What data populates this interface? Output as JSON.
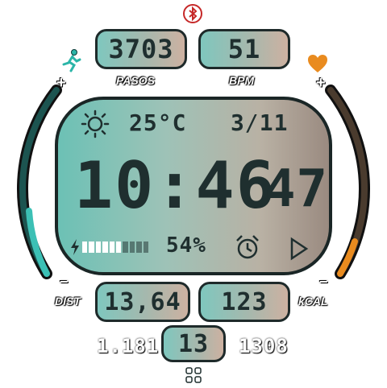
{
  "top": {
    "bluetooth_icon": "bluetooth-icon"
  },
  "steps": {
    "value": "3703",
    "label": "PASOS"
  },
  "heart": {
    "value": "51",
    "label": "BPM"
  },
  "main": {
    "temperature": "25°C",
    "date_day": "3",
    "date_sep": "/",
    "date_month": "11",
    "time_hm": "10:46",
    "time_sec": "47",
    "battery_pct": "54%",
    "battery_level": 0.54
  },
  "left_gauge": {
    "plus": "+",
    "minus": "−"
  },
  "right_gauge": {
    "plus": "+",
    "minus": "−"
  },
  "distance": {
    "value": "13,64",
    "label": "DIST"
  },
  "calories": {
    "value": "123",
    "label": "kCAL"
  },
  "bottom": {
    "left_text": "1.181",
    "center_value": "13",
    "right_text": "1308"
  },
  "colors": {
    "accent_teal": "#3cc0b5",
    "accent_orange": "#e98b1f",
    "bluetooth": "#c62828"
  }
}
